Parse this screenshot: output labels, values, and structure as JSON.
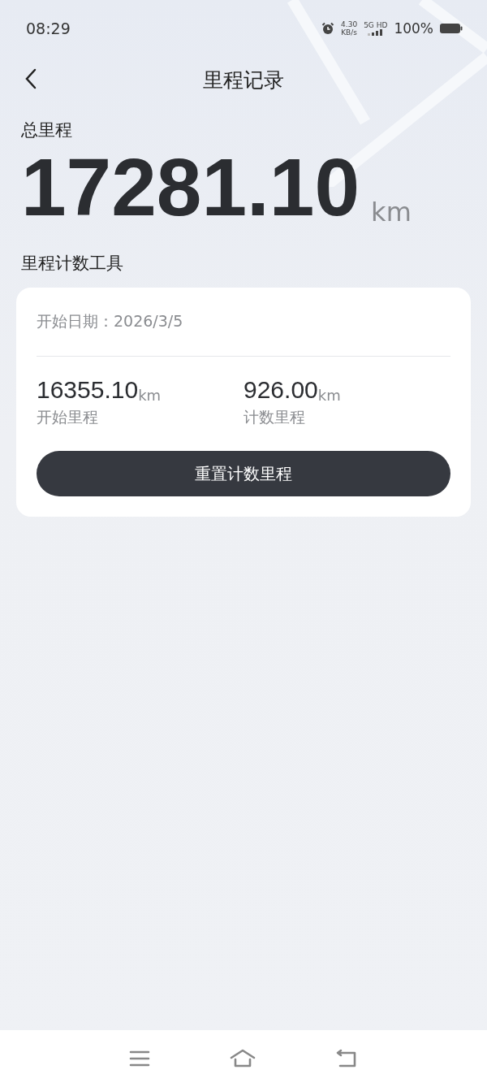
{
  "status_bar": {
    "time": "08:29",
    "net_speed": "4.30",
    "net_unit": "KB/s",
    "network": "5G HD",
    "battery": "100%"
  },
  "header": {
    "title": "里程记录"
  },
  "total": {
    "label": "总里程",
    "value": "17281.10",
    "unit": "km"
  },
  "tool": {
    "title": "里程计数工具",
    "start_date": "开始日期：2026/3/5",
    "stats": [
      {
        "value": "16355.10",
        "unit": "km",
        "label": "开始里程"
      },
      {
        "value": "926.00",
        "unit": "km",
        "label": "计数里程"
      }
    ],
    "button": "重置计数里程"
  }
}
